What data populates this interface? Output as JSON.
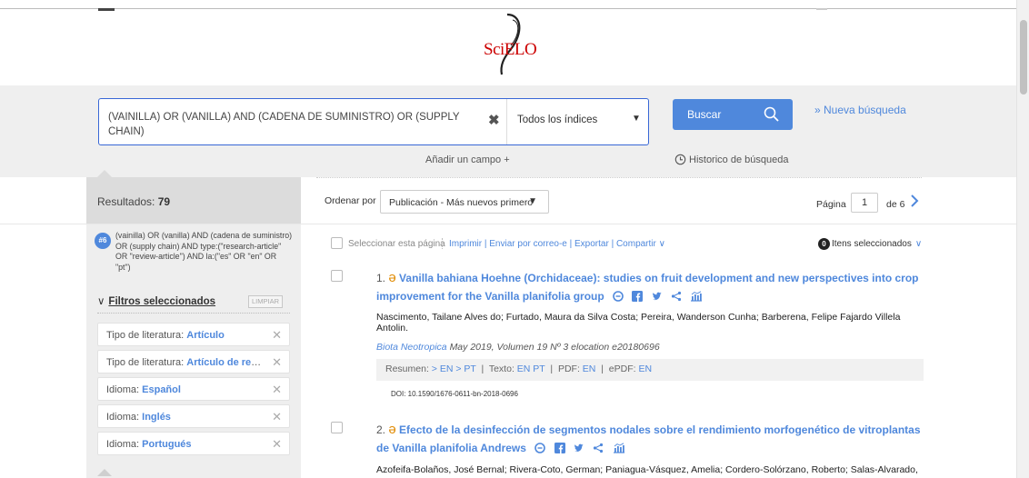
{
  "logo": {
    "text": "SciELO"
  },
  "search": {
    "query": "(VAINILLA) OR (VANILLA) AND (CADENA DE SUMINISTRO) OR (SUPPLY CHAIN)",
    "index_selected": "Todos los índices",
    "button": "Buscar",
    "new_search": "» Nueva búsqueda",
    "add_field": "Añadir un campo +",
    "history": "Historico de búsqueda"
  },
  "sidebar": {
    "results_label": "Resultados:",
    "results_count": "79",
    "query_badge": "#6",
    "query_text": "(vainilla) OR (vanilla) AND (cadena de suministro) OR (supply chain) AND type:(\"research-article\" OR \"review-article\") AND la:(\"es\" OR \"en\" OR \"pt\")",
    "filters_title": "Filtros seleccionados",
    "clear_label": "LIMPIAR",
    "filters": [
      {
        "key": "Tipo de literatura:",
        "value": "Artículo"
      },
      {
        "key": "Tipo de literatura:",
        "value": "Artículo de revisi..."
      },
      {
        "key": "Idioma:",
        "value": "Español"
      },
      {
        "key": "Idioma:",
        "value": "Inglés"
      },
      {
        "key": "Idioma:",
        "value": "Portugués"
      }
    ]
  },
  "toolbar": {
    "sort_label": "Ordenar por",
    "sort_value": "Publicación - Más nuevos primero",
    "page_label": "Página",
    "page_current": "1",
    "page_total": "de 6",
    "select_page": "Seleccionar esta página",
    "actions": "Imprimir | Enviar por correo-e | Exportar | Compartir",
    "selected_count": "0",
    "selected_label": "Itens seleccionados"
  },
  "results": [
    {
      "number": "1.",
      "title": "Vanilla bahiana Hoehne (Orchidaceae): studies on fruit development and new perspectives into crop improvement for the Vanilla planifolia group",
      "authors": "Nascimento, Tailane Alves do; Furtado, Maura da Silva Costa; Pereira, Wanderson Cunha; Barberena, Felipe Fajardo Villela Antolin.",
      "journal": "Biota Neotropica",
      "source_rest": "May 2019, Volumen 19   Nº 3   elocation e20180696",
      "resumen_label": "Resumen:",
      "texto_label": "Texto:",
      "pdf_label": "PDF:",
      "epdf_label": "ePDF:",
      "doi": "DOI: 10.1590/1676-0611-bn-2018-0696"
    },
    {
      "number": "2.",
      "title": "Efecto de la desinfección de segmentos nodales sobre el rendimiento morfogenético de vitroplantas de Vanilla planifolia Andrews",
      "authors": "Azofeifa-Bolaños, José Bernal; Rivera-Coto, German; Paniagua-Vásquez, Amelia; Cordero-Solórzano, Roberto; Salas-Alvarado,"
    }
  ],
  "colors": {
    "accent": "#4f88dc",
    "open_access": "#e08a00",
    "logo_red": "#cc0000"
  }
}
